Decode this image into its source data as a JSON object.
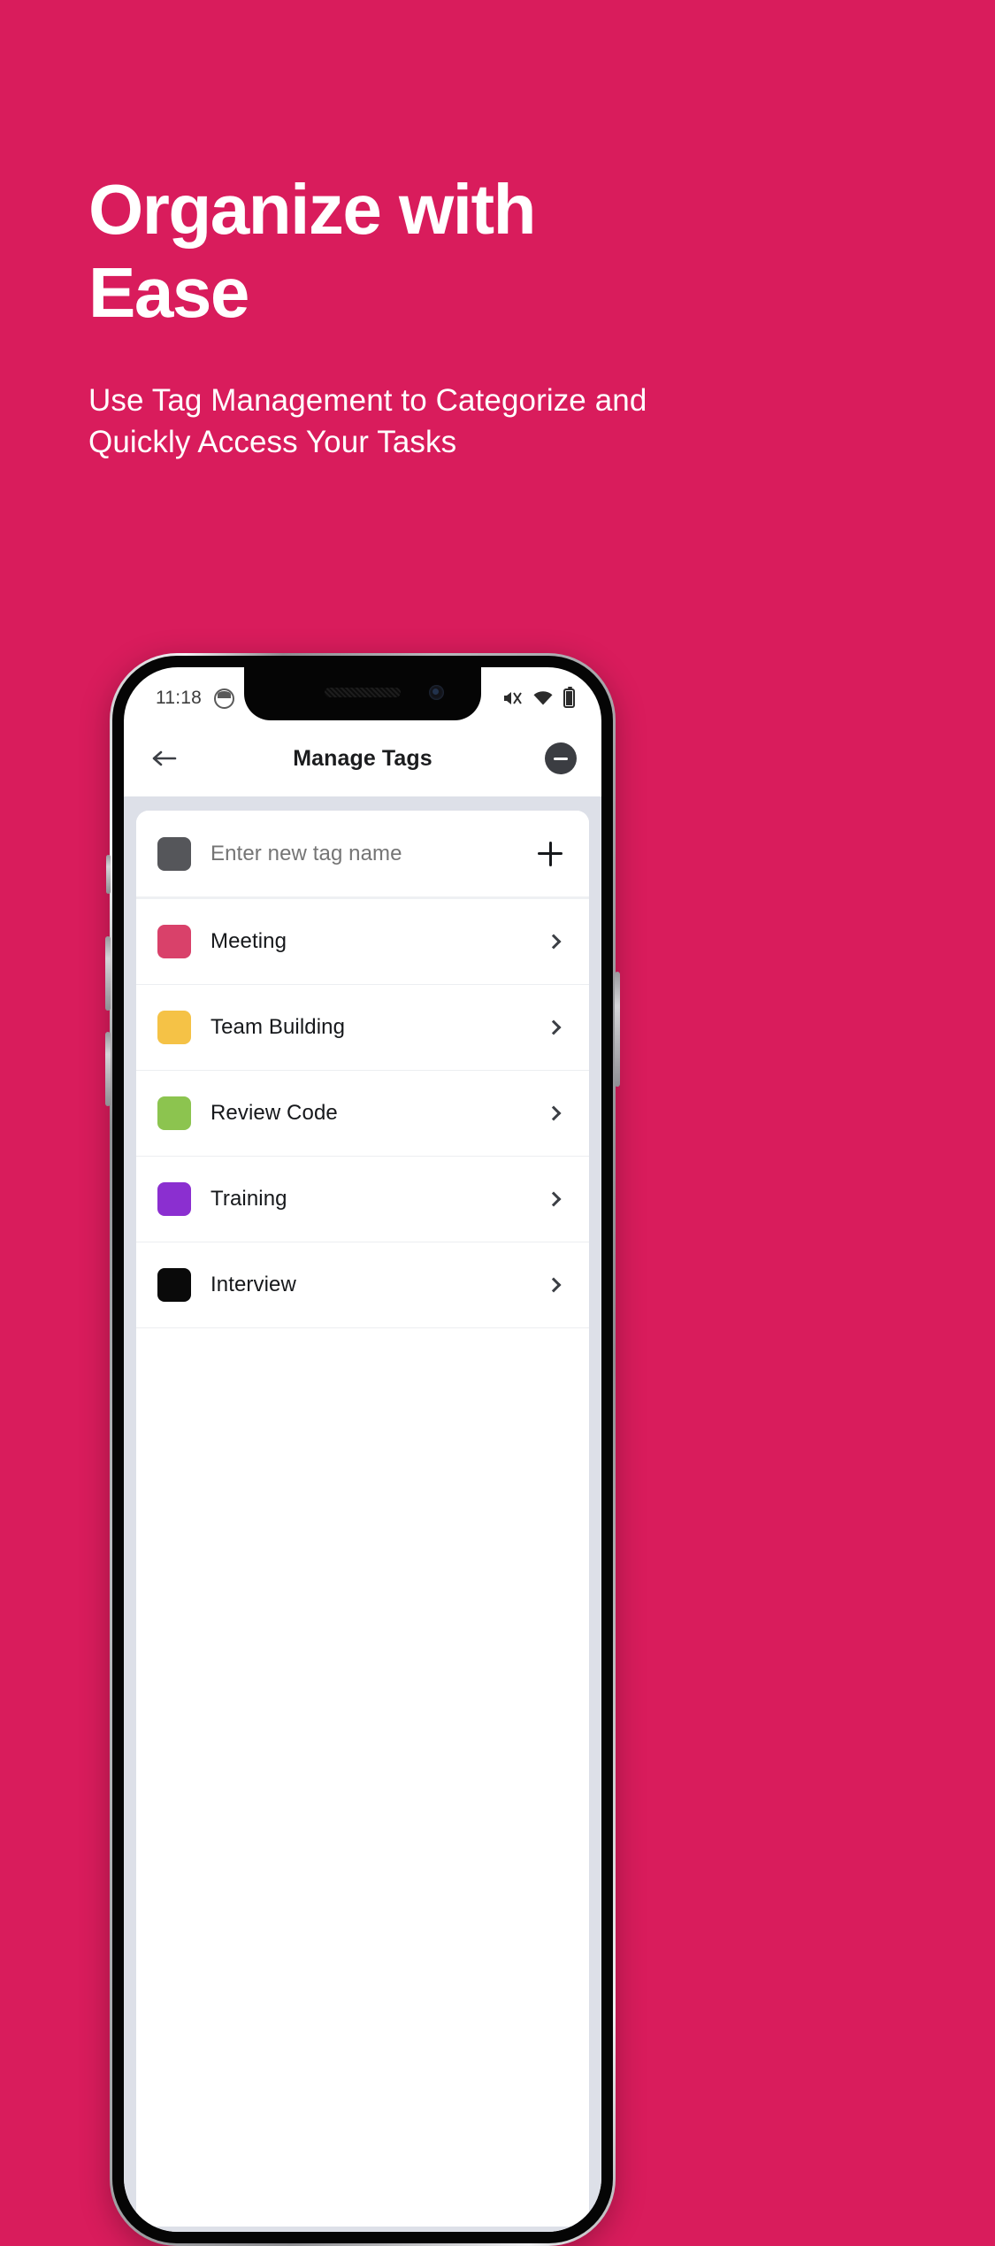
{
  "background_color": "#d91c5c",
  "hero": {
    "title": "Organize with\nEase",
    "subtitle": "Use Tag Management to Categorize and\nQuickly Access Your Tasks"
  },
  "phone": {
    "status_bar": {
      "time": "11:18",
      "app_icon": "cat-avatar-icon",
      "icons": [
        "mute-icon",
        "wifi-icon",
        "battery-icon"
      ]
    },
    "header": {
      "back_icon": "back-arrow-icon",
      "title": "Manage Tags",
      "action_icon": "minus-circle-icon"
    },
    "new_tag_row": {
      "swatch_color": "#55565a",
      "placeholder": "Enter new tag name",
      "value": "",
      "add_icon": "plus-icon"
    },
    "tags": [
      {
        "name": "Meeting",
        "color": "#d9416a",
        "chevron": "chevron-right-icon"
      },
      {
        "name": "Team Building",
        "color": "#f5c246",
        "chevron": "chevron-right-icon"
      },
      {
        "name": "Review Code",
        "color": "#8cc44f",
        "chevron": "chevron-right-icon"
      },
      {
        "name": "Training",
        "color": "#8b2fd0",
        "chevron": "chevron-right-icon"
      },
      {
        "name": "Interview",
        "color": "#0a0a0a",
        "chevron": "chevron-right-icon"
      }
    ]
  }
}
